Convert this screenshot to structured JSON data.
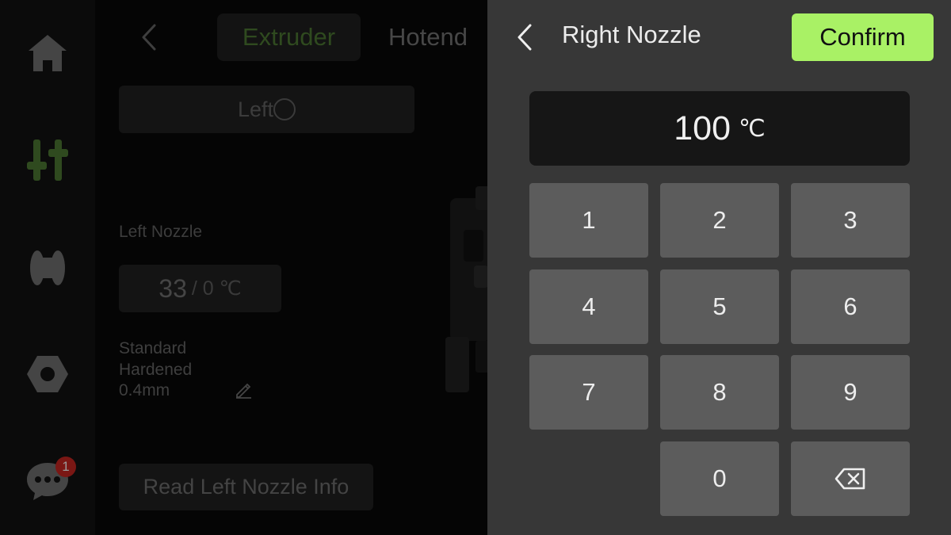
{
  "sidebar": {
    "items": [
      {
        "name": "home",
        "icon": "home-icon"
      },
      {
        "name": "controls",
        "icon": "sliders-icon",
        "active": true
      },
      {
        "name": "filament",
        "icon": "spool-icon"
      },
      {
        "name": "settings",
        "icon": "nut-icon"
      },
      {
        "name": "messages",
        "icon": "chat-icon"
      }
    ],
    "message_badge": "1"
  },
  "header": {
    "tabs": [
      {
        "label": "Extruder",
        "active": true
      },
      {
        "label": "Hotend",
        "active": false
      }
    ]
  },
  "extruder": {
    "side_toggle_label": "Left",
    "nozzle_label": "Left Nozzle",
    "current_temp": "33",
    "target_temp": "/ 0 ℃",
    "nozzle_type_line1": "Standard",
    "nozzle_type_line2": "Hardened",
    "nozzle_size": "0.4mm",
    "read_button": "Read Left Nozzle Info"
  },
  "keypad_panel": {
    "title": "Right Nozzle",
    "confirm_label": "Confirm",
    "value": "100",
    "unit": "℃",
    "keys": [
      "1",
      "2",
      "3",
      "4",
      "5",
      "6",
      "7",
      "8",
      "9",
      "0"
    ],
    "backspace_icon": "backspace-icon"
  },
  "colors": {
    "accent": "#a9f165",
    "panel_bg": "#373737",
    "key_bg": "#5c5c5c",
    "display_bg": "#161616",
    "badge": "#7a1714"
  }
}
